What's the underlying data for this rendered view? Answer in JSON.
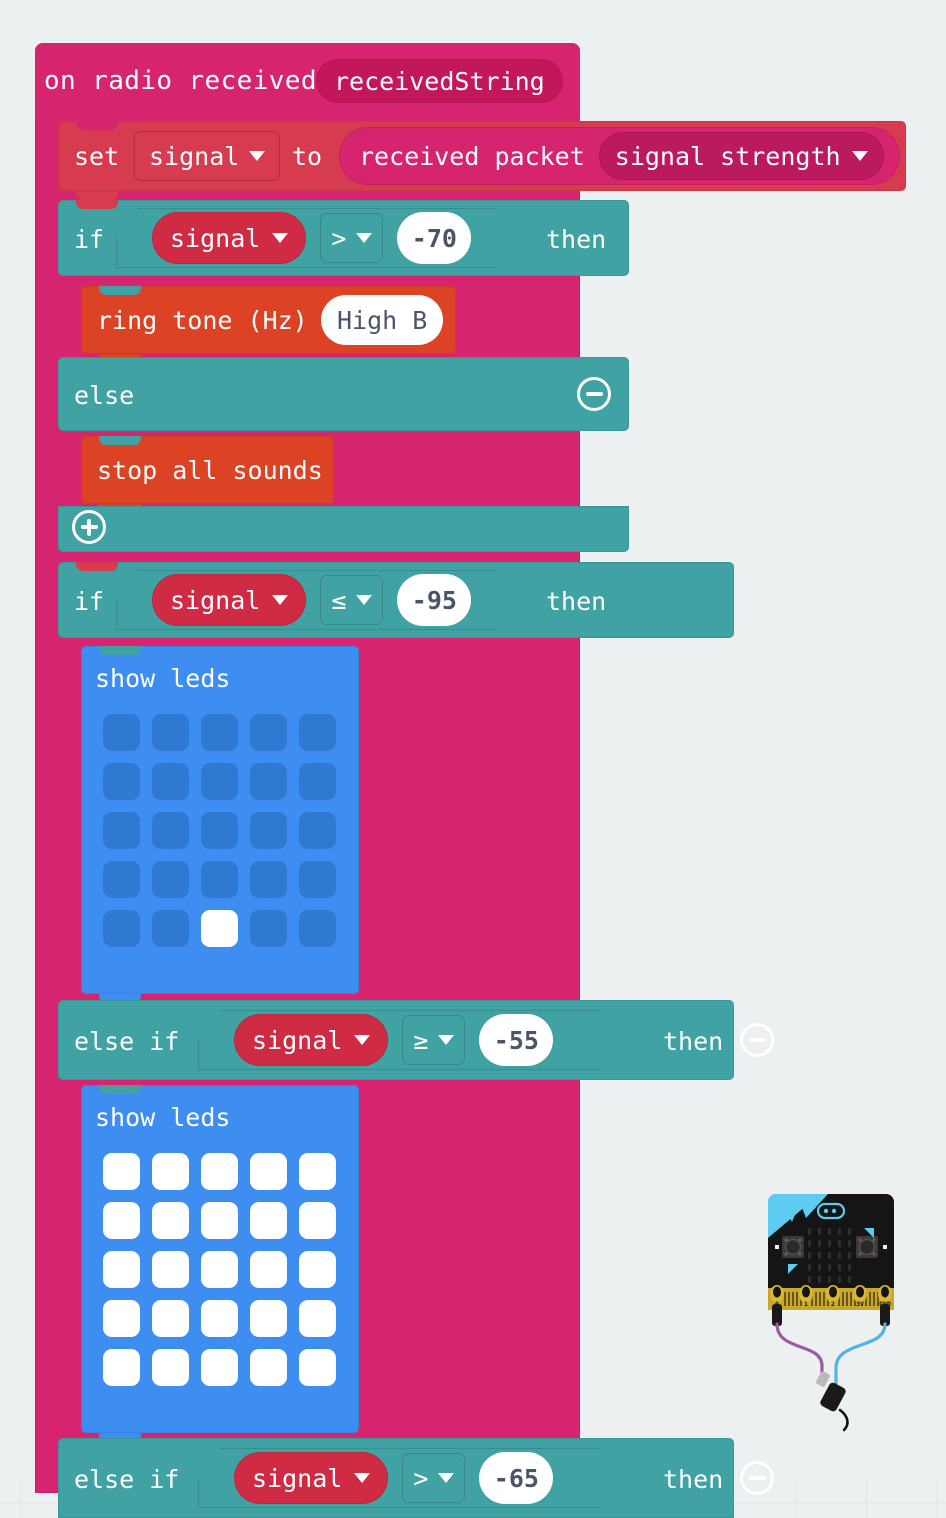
{
  "workspace": {
    "background_color": "#ecf0f1",
    "grid_marker": "plus-marker"
  },
  "colors": {
    "event_pink": "#d6246e",
    "variables_red": "#d73b4f",
    "logic_teal": "#41a2a4",
    "music_red": "#dc4325",
    "led_blue": "#3d8ef0",
    "radio_pink": "#d6246e"
  },
  "event_block": {
    "title": "on radio received",
    "parameter": "receivedString"
  },
  "set_block": {
    "set_label": "set",
    "variable": "signal",
    "to_label": "to",
    "value_block": {
      "label": "received packet",
      "field": "signal strength"
    }
  },
  "if_block_1": {
    "if_label": "if",
    "condition": {
      "left": "signal",
      "operator": ">",
      "right": "-70"
    },
    "then_label": "then",
    "body": [
      {
        "type": "music",
        "label": "ring tone (Hz)",
        "value": "High B"
      }
    ],
    "else_label": "else",
    "else_body": [
      {
        "type": "music",
        "label": "stop all sounds"
      }
    ],
    "remove_icon": "minus-circle-icon",
    "add_icon": "plus-circle-icon"
  },
  "if_block_2": {
    "if_label": "if",
    "condition": {
      "left": "signal",
      "operator": "≤",
      "right": "-95"
    },
    "then_label": "then",
    "body": [
      {
        "type": "show-leds",
        "label": "show leds",
        "pattern": [
          [
            0,
            0,
            0,
            0,
            0
          ],
          [
            0,
            0,
            0,
            0,
            0
          ],
          [
            0,
            0,
            0,
            0,
            0
          ],
          [
            0,
            0,
            0,
            0,
            0
          ],
          [
            0,
            0,
            1,
            0,
            0
          ]
        ]
      }
    ],
    "else_if_1": {
      "label": "else if",
      "condition": {
        "left": "signal",
        "operator": "≥",
        "right": "-55"
      },
      "then_label": "then",
      "remove_icon": "minus-circle-icon",
      "body": [
        {
          "type": "show-leds",
          "label": "show leds",
          "pattern": [
            [
              1,
              1,
              1,
              1,
              1
            ],
            [
              1,
              1,
              1,
              1,
              1
            ],
            [
              1,
              1,
              1,
              1,
              1
            ],
            [
              1,
              1,
              1,
              1,
              1
            ],
            [
              1,
              1,
              1,
              1,
              1
            ]
          ]
        }
      ]
    },
    "else_if_2": {
      "label": "else if",
      "condition": {
        "left": "signal",
        "operator": ">",
        "right": "-65"
      },
      "then_label": "then",
      "remove_icon": "minus-circle-icon"
    }
  },
  "microbit": {
    "pin_labels": [
      "0",
      "1",
      "2",
      "3V",
      "GND"
    ],
    "wire_colors": {
      "pin0": "#9b5ba3",
      "gnd": "#4fb3e8"
    }
  }
}
